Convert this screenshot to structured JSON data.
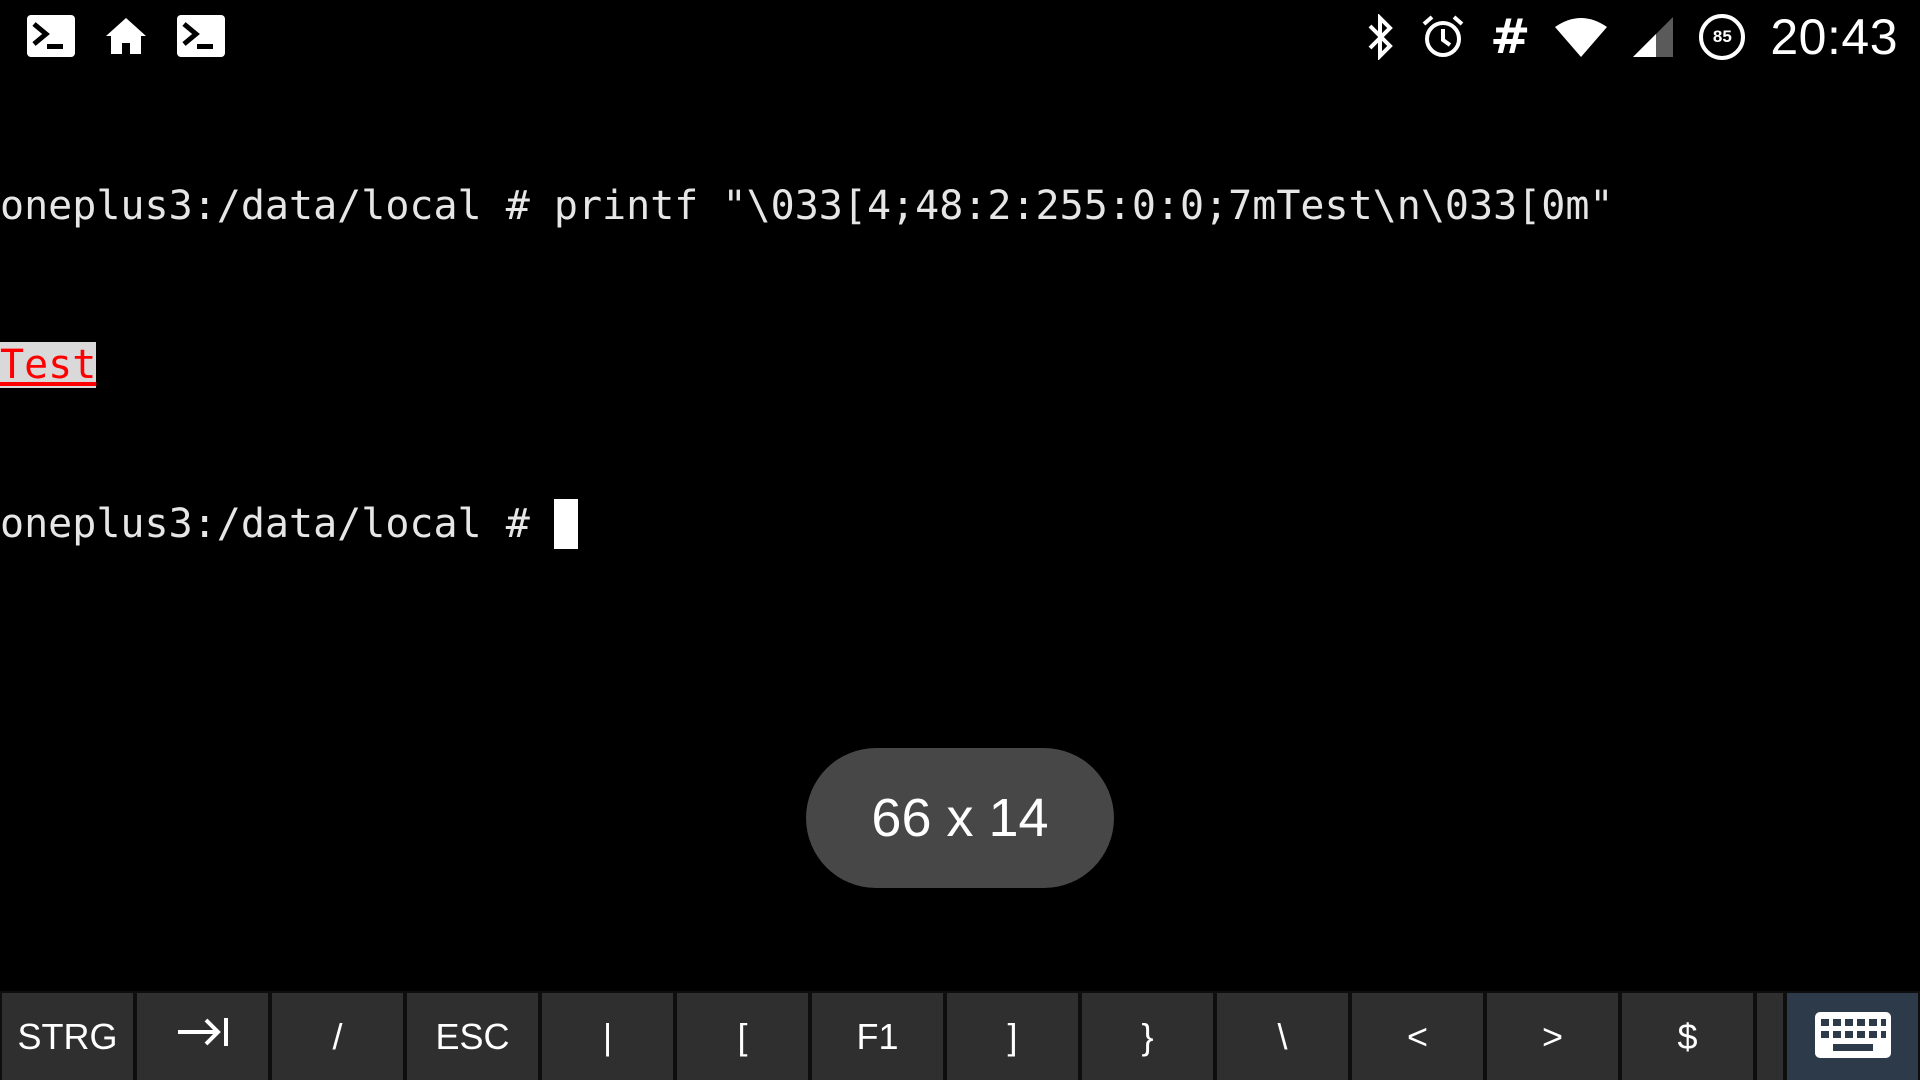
{
  "status_bar": {
    "left_icons": [
      "terminal-icon",
      "home-icon",
      "terminal-icon"
    ],
    "right_icons": [
      "bluetooth-icon",
      "alarm-icon",
      "hash-icon",
      "wifi-icon",
      "cell-signal-icon",
      "battery-icon"
    ],
    "hash_symbol": "#",
    "battery_level": "85",
    "time": "20:43"
  },
  "terminal": {
    "line1": "oneplus3:/data/local # printf \"\\033[4;48:2:255:0:0;7mTest\\n\\033[0m\"",
    "line2_styled": "Test",
    "line3_prompt": "oneplus3:/data/local # "
  },
  "toast": {
    "text": "66 x 14"
  },
  "extra_keys": {
    "keys": [
      "STRG",
      "→I",
      "/",
      "ESC",
      "|",
      "[",
      "F1",
      "]",
      "}",
      "\\",
      "<",
      ">",
      "$"
    ],
    "keyboard_toggle_icon": "keyboard-icon"
  },
  "colors": {
    "terminal_bg": "#000000",
    "terminal_fg": "#e6e6e6",
    "styled_fg": "#ff0000",
    "styled_bg": "#d9d9d9",
    "toast_bg": "#474747",
    "key_bg": "#2f2f2f",
    "keyboard_key_bg": "#2c3a4a"
  }
}
